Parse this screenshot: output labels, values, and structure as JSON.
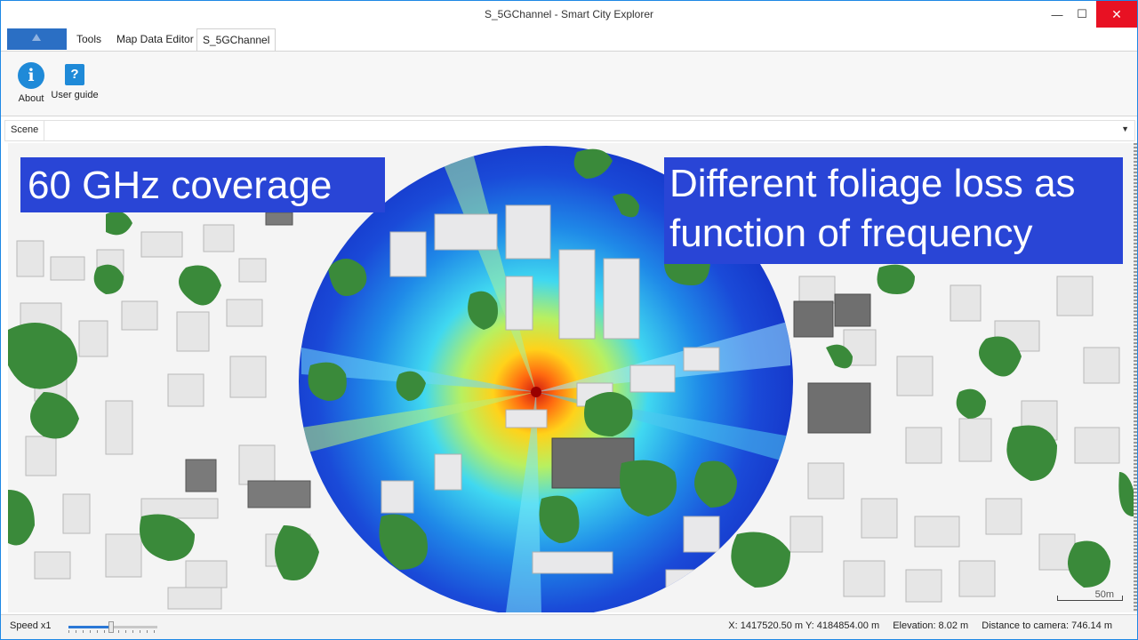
{
  "window": {
    "title": "S_5GChannel - Smart City Explorer"
  },
  "controls": {
    "minimize": "—",
    "maximize": "☐",
    "close": "✕"
  },
  "menu": {
    "tabs": [
      "Tools",
      "Map Data Editor",
      "S_5GChannel"
    ],
    "active_tab": "S_5GChannel"
  },
  "ribbon": {
    "buttons": [
      {
        "label": "About",
        "icon": "info-icon"
      },
      {
        "label": "User guide",
        "icon": "help-icon"
      }
    ]
  },
  "scene": {
    "label": "Scene",
    "overlay_left": "60 GHz coverage",
    "overlay_right_line1": "Different foliage loss as",
    "overlay_right_line2": "function of frequency",
    "scale_label": "50m"
  },
  "status": {
    "speed_label": "Speed x1",
    "speed_level": 0.48,
    "coords": "X: 1417520.50 m Y: 4184854.00 m",
    "elevation": "Elevation: 8.02 m",
    "distance": "Distance to camera: 746.14 m"
  },
  "colors": {
    "accent": "#2b6fc4",
    "overlay_bg": "#2945d6",
    "close_button": "#e81123",
    "foliage": "#3a8a3a",
    "coverage_peak": "#e03010",
    "coverage_low": "#1a3fd0"
  }
}
